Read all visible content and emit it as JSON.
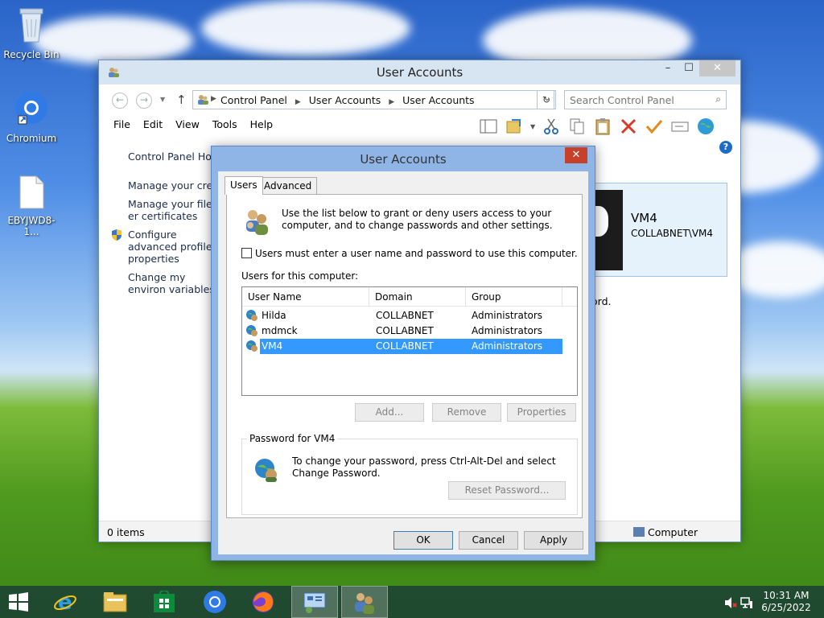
{
  "desktop": {
    "icons": [
      {
        "label": "Recycle Bin",
        "icon": "recycle-bin-icon"
      },
      {
        "label": "Chromium",
        "icon": "chromium-icon"
      },
      {
        "label": "EBYJWD8-1...",
        "icon": "file-icon"
      }
    ]
  },
  "control_panel": {
    "title": "User Accounts",
    "breadcrumb": [
      "Control Panel",
      "User Accounts",
      "User Accounts"
    ],
    "search_placeholder": "Search Control Panel",
    "menu": [
      "File",
      "Edit",
      "View",
      "Tools",
      "Help"
    ],
    "left_links": [
      "Control Panel Hom",
      "Manage your crede",
      "Manage your file er certificates",
      "Configure advanced profile properties",
      "Change my environ variables"
    ],
    "user_panel": {
      "name": "VM4",
      "domain": "COLLABNET\\VM4"
    },
    "fragment_text": "ord.",
    "status": {
      "items": "0 items",
      "location": "Computer"
    }
  },
  "dialog": {
    "title": "User Accounts",
    "tabs": [
      "Users",
      "Advanced"
    ],
    "intro": "Use the list below to grant or deny users access to your computer, and to change passwords and other settings.",
    "checkbox_label": "Users must enter a user name and password to use this computer.",
    "checkbox_checked": false,
    "users_label": "Users for this computer:",
    "columns": [
      "User Name",
      "Domain",
      "Group"
    ],
    "users": [
      {
        "name": "Hilda",
        "domain": "COLLABNET",
        "group": "Administrators",
        "selected": false
      },
      {
        "name": "mdmck",
        "domain": "COLLABNET",
        "group": "Administrators",
        "selected": false
      },
      {
        "name": "VM4",
        "domain": "COLLABNET",
        "group": "Administrators",
        "selected": true
      }
    ],
    "buttons": {
      "add": "Add...",
      "remove": "Remove",
      "properties": "Properties"
    },
    "password_group": "Password for VM4",
    "password_text": "To change your password, press Ctrl-Alt-Del and select Change Password.",
    "reset_button": "Reset Password...",
    "ok": "OK",
    "cancel": "Cancel",
    "apply": "Apply"
  },
  "taskbar": {
    "time": "10:31 AM",
    "date": "6/25/2022"
  },
  "colors": {
    "selection": "#3399ff",
    "taskbar": "#1c4234"
  }
}
